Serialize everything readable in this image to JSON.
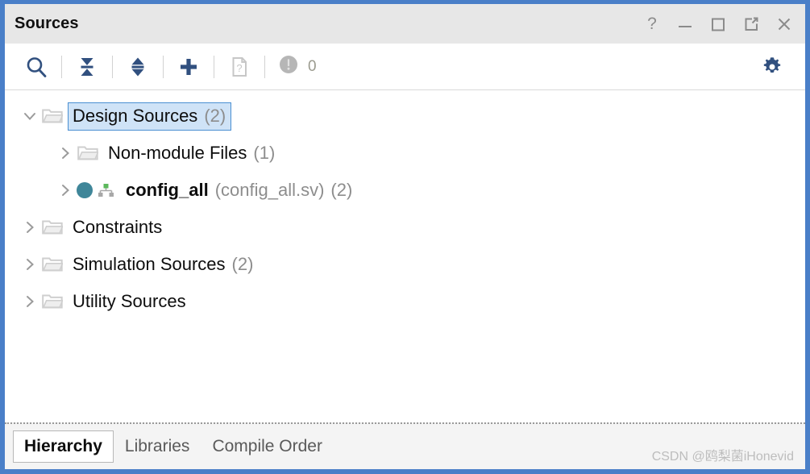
{
  "window": {
    "title": "Sources",
    "accent_color": "#4a7fc8",
    "titlebar_bg": "#e7e7e7",
    "icon_color": "#31507f",
    "selection_bg": "#cfe3f7"
  },
  "titlebar": {
    "buttons": [
      {
        "name": "help-icon",
        "label": "?"
      },
      {
        "name": "minimize-icon",
        "label": "–"
      },
      {
        "name": "maximize-icon",
        "label": "□"
      },
      {
        "name": "float-icon",
        "label": "↗"
      },
      {
        "name": "close-icon",
        "label": "×"
      }
    ]
  },
  "toolbar": {
    "search_tooltip": "Search",
    "collapse_tooltip": "Collapse All",
    "expand_tooltip": "Expand All",
    "add_tooltip": "Add Sources",
    "unknown_files_tooltip": "Unknown Files",
    "warning_count": "0",
    "settings_tooltip": "Settings"
  },
  "tree": {
    "rows": [
      {
        "name": "design-sources",
        "indent": 1,
        "expanded": true,
        "selected": true,
        "icon": "folder-icon",
        "label": "Design Sources",
        "count": "(2)",
        "sub": "",
        "bold": false
      },
      {
        "name": "non-module-files",
        "indent": 2,
        "expanded": false,
        "selected": false,
        "icon": "folder-icon",
        "label": "Non-module Files",
        "count": "(1)",
        "sub": "",
        "bold": false
      },
      {
        "name": "config-all-module",
        "indent": 2,
        "expanded": false,
        "selected": false,
        "icon": "module-icon",
        "label": "config_all",
        "count": "(2)",
        "sub": "(config_all.sv)",
        "bold": true
      },
      {
        "name": "constraints",
        "indent": 1,
        "expanded": false,
        "selected": false,
        "icon": "folder-icon",
        "label": "Constraints",
        "count": "",
        "sub": "",
        "bold": false
      },
      {
        "name": "simulation-sources",
        "indent": 1,
        "expanded": false,
        "selected": false,
        "icon": "folder-icon",
        "label": "Simulation Sources",
        "count": "(2)",
        "sub": "",
        "bold": false
      },
      {
        "name": "utility-sources",
        "indent": 1,
        "expanded": false,
        "selected": false,
        "icon": "folder-icon",
        "label": "Utility Sources",
        "count": "",
        "sub": "",
        "bold": false
      }
    ]
  },
  "footer": {
    "tabs": [
      {
        "name": "tab-hierarchy",
        "label": "Hierarchy",
        "active": true
      },
      {
        "name": "tab-libraries",
        "label": "Libraries",
        "active": false
      },
      {
        "name": "tab-compile-order",
        "label": "Compile Order",
        "active": false
      }
    ],
    "watermark": "CSDN @鸥梨菌iHonevid"
  }
}
